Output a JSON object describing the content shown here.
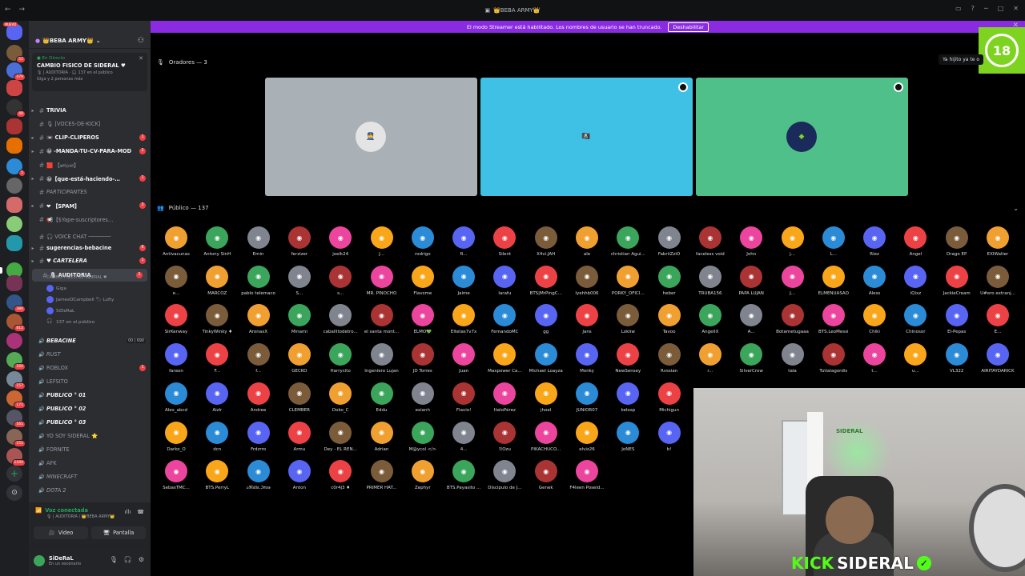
{
  "titlebar": {
    "title": "👑BEBA ARMY👑"
  },
  "banner": {
    "text": "El modo Streamer está habilitado. Los nombres de usuario se han truncado.",
    "button": "Deshabilitar"
  },
  "rail": {
    "new_badge": "NUEVO"
  },
  "guild": {
    "name": "👑BEBA ARMY👑"
  },
  "event": {
    "live": "● En Directo",
    "name": "CAMBIO FISICO DE SIDERAL ♥",
    "location": "🎙 | AUDITORIA · 🎧 137 en el público",
    "attendees": "Giga y 2 personas más"
  },
  "channels": [
    {
      "label": "TRIVIA",
      "style": "bold",
      "arrow": "▸"
    },
    {
      "label": "🎙 [VOCES-DE-KICK]",
      "style": "",
      "arrow": ""
    },
    {
      "label": "📼 CLIP-CLIPEROS",
      "style": "bold",
      "arrow": "▸",
      "mention": "1"
    },
    {
      "label": "😀 -MANDA-TU-CV-PARA-MOD",
      "style": "bold",
      "arrow": "▸",
      "mention": "1"
    },
    {
      "label": "🟥 【𝔰𝔬𝔟𝔧𝔢𝔱𝔬】",
      "style": "",
      "arrow": ""
    },
    {
      "label": "😀【que-está-haciendo-…",
      "style": "bold",
      "arrow": "▸",
      "mention": "1"
    },
    {
      "label": "PARTICIPANTES",
      "style": "italic",
      "arrow": ""
    },
    {
      "label": "❤ 【SPAM】",
      "style": "bold",
      "arrow": "▸",
      "mention": "3"
    },
    {
      "label": "📢【$Yape-suscriptores…",
      "style": "",
      "arrow": ""
    },
    {
      "label": "🎧 VOICE CHAT ───────",
      "style": "",
      "arrow": ""
    },
    {
      "label": "sugerencias-bebacine",
      "style": "bold",
      "arrow": "▸",
      "mention": "6"
    },
    {
      "label": "♥ CARTELERA",
      "style": "bold italic",
      "arrow": "▸",
      "mention": "1"
    },
    {
      "label": "🎙 AUDITORIA",
      "style": "bold selected",
      "arrow": "",
      "mention": "1"
    }
  ],
  "auditoria_sub": "CAMBIO FISICO DE SIDERAL ♥",
  "voice_users": [
    {
      "name": "Giga"
    },
    {
      "name": "JamesOCampbell 🏷 Lufty"
    },
    {
      "name": "SiDeRaL"
    },
    {
      "name": "137 en el público"
    }
  ],
  "channels2": [
    {
      "label": "BEBACINE",
      "style": "bold italic",
      "count": "00 | 690"
    },
    {
      "label": "RUST",
      "style": "italic"
    },
    {
      "label": "ROBLOX",
      "style": "",
      "mention": "1"
    },
    {
      "label": "LEFSITO",
      "style": ""
    },
    {
      "label": "PUBLICO ° 01",
      "style": "bold italic"
    },
    {
      "label": "PUBLICO ° 02",
      "style": "bold italic"
    },
    {
      "label": "PUBLICO ° 03",
      "style": "bold italic"
    },
    {
      "label": "YO SOY SIDERAL ⭐",
      "style": ""
    },
    {
      "label": "FORNITE",
      "style": ""
    },
    {
      "label": "AFK",
      "style": ""
    },
    {
      "label": "MINECRAFT",
      "style": "italic"
    },
    {
      "label": "DOTA 2",
      "style": "italic"
    }
  ],
  "voice_panel": {
    "title": "Voz conectada",
    "sub": "🎙 | AUDITORIA / 👑BEBA ARMY👑",
    "video": "Video",
    "screen": "Pantalla"
  },
  "user": {
    "name": "SiDeRaL",
    "status": "En un escenario"
  },
  "stage": {
    "speakers_label": "Oradores — 3",
    "audience_label": "Público — 137",
    "tooltip": "Ya hijito ya te o"
  },
  "audience": [
    [
      "Antivacunas",
      "Antony SinH",
      "Emin",
      "ferzizer",
      "joelk24",
      "J...",
      "rodrigo",
      "R...",
      "Silent",
      "X4vi.JAH",
      "ale",
      "christian Agui...",
      "FabriiZziO",
      "faceless void",
      "John",
      "j...",
      "L...",
      "Riez",
      "Angel",
      "Drago EP",
      "EXIWalter"
    ],
    [
      "e...",
      "MARCOZ",
      "pablo telemaco",
      "S...",
      "s...",
      "MR. PINOCHO",
      "Flavsme",
      "Jaime",
      "larafu",
      "BTS|MrPingC...",
      "lyehhb006",
      "PORKY_OFICI...",
      "heber",
      "TRUBA156",
      "PAPA LUJAN",
      "J...",
      "ELMENUASAO",
      "Aless",
      "iQixz",
      "JackieCream",
      "U#ero extranj..."
    ],
    [
      "SirKenway",
      "TinkyWinky ♦",
      "AronaxX",
      "Minami",
      "caballitodetro...",
      "el santa mont...",
      "ELMO💚",
      "Eltetas7v7x",
      "FernandoMC",
      "gg",
      "Jans",
      "Lokiiw",
      "Tavoo",
      "AngelIX",
      "A...",
      "Botametugaaa",
      "BTS.LeoMessi",
      "Chiki",
      "Chinosor",
      "El-Pepas",
      "E..."
    ],
    [
      "faraon",
      "F...",
      "f...",
      "GECKO",
      "Harrycito",
      "Ingeniero Lujan",
      "JD Torres",
      "Juan",
      "Maxpower Ca...",
      "Michael Loayza",
      "Monky",
      "NewSensey",
      "Rvssian",
      "r...",
      "SilverCrow",
      "tala",
      "Tutialagordis",
      "t...",
      "u...",
      "VL322",
      "AIRITAYDARICK"
    ],
    [
      "Alex_abcd",
      "Aizlr",
      "Andree",
      "CLEMBER",
      "Doko_C",
      "Eddu",
      "exianh",
      "Flavio!",
      "ItaloPérez",
      "jhoel",
      "JUNIOR07",
      "kelsop",
      "Michigun"
    ],
    [
      "Darko_O",
      "dcn",
      "Frdzrro",
      "Armu",
      "Dey - EL REN...",
      "Adrian",
      "M@ycol </>",
      "4...",
      "ℬOzu",
      "PIKACHUCO...",
      "elviz26",
      "JoNES",
      "b!"
    ],
    [
      "SebasTMC...",
      "BTS.PerryL",
      "ঌ𝔐𝔞𝔩𝔦𝔞.ℑ𝔬𝔯𝔞𝔰",
      "Anton",
      "c0r4j3 ♦",
      "PRIMER HAT...",
      "Zephyr",
      "BTS.Payasito ...",
      "Discipulo de J...",
      "Genek",
      "F4leen Poseid..."
    ]
  ],
  "colors": {
    "accent": "#5865f2",
    "live": "#23a55a",
    "banner": "#8a2be2",
    "mention": "#f23f43",
    "tile1": "#a9b1b7",
    "tile2": "#3fc1e6",
    "tile3": "#4fc08a",
    "kick": "#53fc18"
  },
  "overlay": {
    "badge": "18",
    "kick": "KICK",
    "name": "SIDERAL",
    "sign": "SIDERAL"
  }
}
